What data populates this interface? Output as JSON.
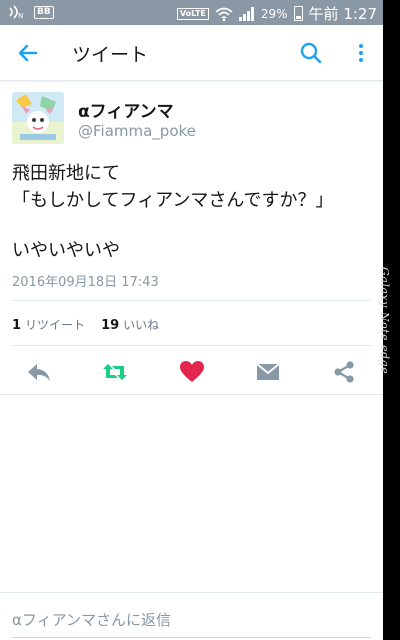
{
  "status_bar": {
    "battery": "29%",
    "time": "午前 1:27",
    "volte": "VoLTE",
    "left_badge": "BB",
    "icons": [
      "nfc-icon",
      "app-badge-icon",
      "volte-icon",
      "wifi-icon",
      "signal-icon",
      "battery-icon"
    ]
  },
  "app_bar": {
    "title": "ツイート",
    "icons": [
      "back-arrow-icon",
      "search-icon",
      "more-vert-icon"
    ]
  },
  "tweet": {
    "display_name": "αフィアンマ",
    "handle": "@Fiamma_poke",
    "text_lines": [
      "飛田新地にて",
      "「もしかしてフィアンマさんですか？」",
      "",
      "いやいやいや"
    ],
    "timestamp": "2016年09月18日 17:43",
    "retweet_count": "1",
    "retweet_label": "リツイート",
    "like_count": "19",
    "like_label": "いいね"
  },
  "actions": [
    {
      "name": "reply-icon",
      "color": "#8899a6"
    },
    {
      "name": "retweet-icon",
      "color": "#19cf86"
    },
    {
      "name": "heart-icon",
      "color": "#e2264d"
    },
    {
      "name": "mail-icon",
      "color": "#8899a6"
    },
    {
      "name": "share-icon",
      "color": "#8899a6"
    }
  ],
  "reply": {
    "placeholder": "αフィアンマさんに返信"
  },
  "device_edge": {
    "text": "Galaxy Note edge"
  },
  "colors": {
    "accent": "#1da1f2",
    "status_bar": "#8a97a4",
    "secondary_text": "#8899a6",
    "like": "#e2264d",
    "retweet": "#19cf86"
  }
}
